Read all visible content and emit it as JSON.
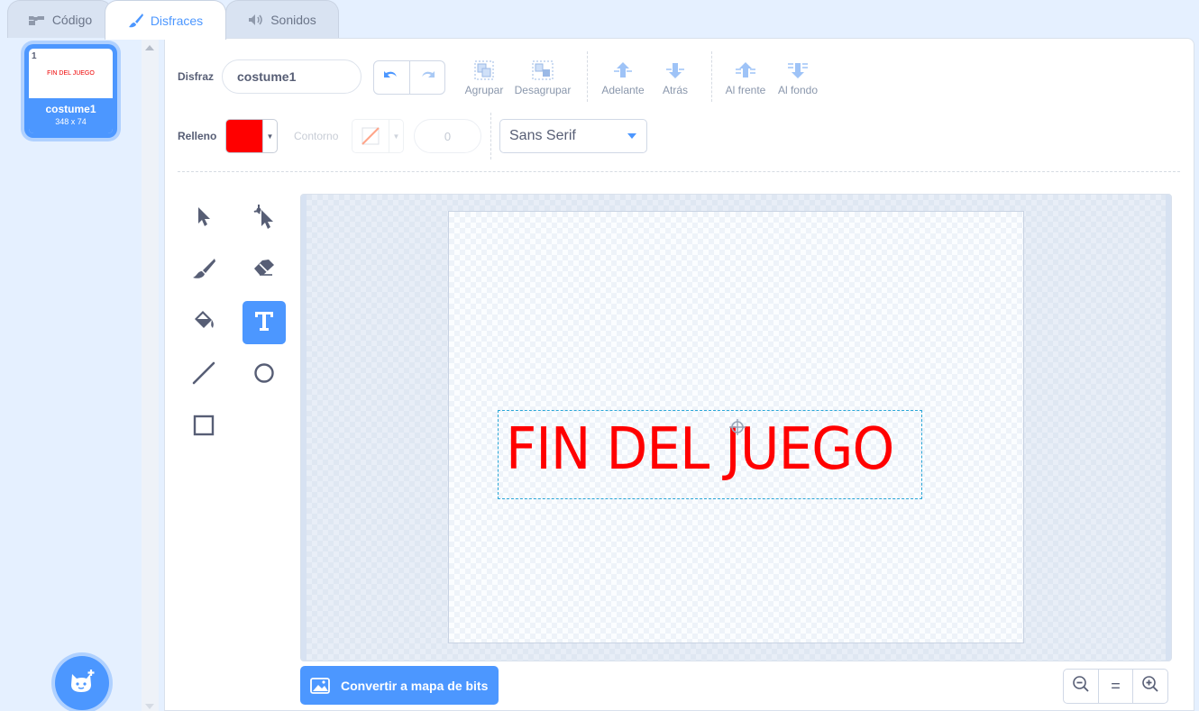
{
  "tabs": [
    {
      "label": "Código",
      "icon": "code-blocks-icon"
    },
    {
      "label": "Disfraces",
      "icon": "paintbrush-icon"
    },
    {
      "label": "Sonidos",
      "icon": "speaker-icon"
    }
  ],
  "costumes": [
    {
      "number": "1",
      "thumbnail_text": "FIN DEL JUEGO",
      "name": "costume1",
      "size": "348 x 74"
    }
  ],
  "toolbar": {
    "costume_label": "Disfraz",
    "costume_name": "costume1",
    "group_label": "Agrupar",
    "ungroup_label": "Desagrupar",
    "forward_label": "Adelante",
    "backward_label": "Atrás",
    "front_label": "Al frente",
    "back_label": "Al fondo",
    "fill_label": "Relleno",
    "fill_color": "#ff0000",
    "outline_label": "Contorno",
    "outline_width": "0",
    "font": "Sans Serif"
  },
  "canvas": {
    "text": "FIN DEL JUEGO",
    "text_color": "#ff0000"
  },
  "convert_button": "Convertir a mapa de bits",
  "zoom": {
    "reset_label": "="
  },
  "colors": {
    "accent": "#4c97ff"
  }
}
